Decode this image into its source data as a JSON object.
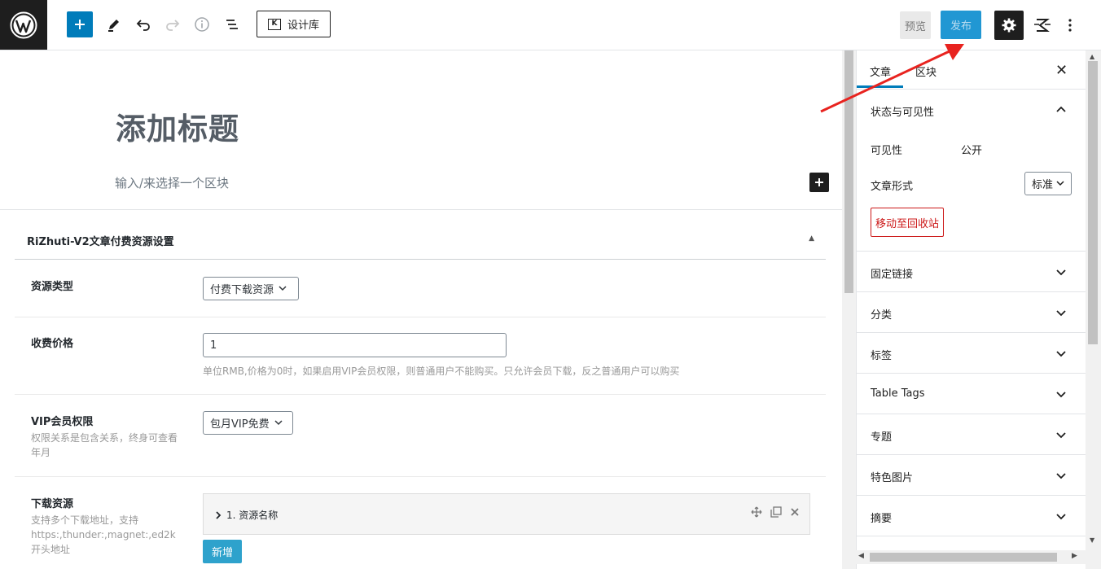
{
  "toolbar": {
    "design_library_label": "设计库",
    "preview_label": "预览",
    "publish_label": "发布"
  },
  "editor": {
    "title_placeholder": "添加标题",
    "block_placeholder": "输入/来选择一个区块"
  },
  "metabox": {
    "title": "RiZhuti-V2文章付费资源设置",
    "resource_type": {
      "label": "资源类型",
      "value": "付费下载资源"
    },
    "price": {
      "label": "收费价格",
      "value": "1",
      "help": "单位RMB,价格为0时，如果启用VIP会员权限，则普通用户不能购买。只允许会员下载，反之普通用户可以购买"
    },
    "vip": {
      "label": "VIP会员权限",
      "desc": "权限关系是包含关系，终身可查看年月",
      "value": "包月VIP免费"
    },
    "downloads": {
      "label": "下载资源",
      "desc": "支持多个下载地址，支持https:,thunder:,magnet:,ed2k 开头地址",
      "item_title": "1. 资源名称",
      "add_label": "新增"
    }
  },
  "sidebar": {
    "tabs": [
      {
        "label": "文章"
      },
      {
        "label": "区块"
      }
    ],
    "status_panel": {
      "title": "状态与可见性",
      "visibility_label": "可见性",
      "visibility_value": "公开",
      "format_label": "文章形式",
      "format_value": "标准",
      "trash_label": "移动至回收站"
    },
    "panels": [
      {
        "title": "固定链接"
      },
      {
        "title": "分类"
      },
      {
        "title": "标签"
      },
      {
        "title": "Table Tags"
      },
      {
        "title": "专题"
      },
      {
        "title": "特色图片"
      },
      {
        "title": "摘要"
      }
    ]
  },
  "colors": {
    "accent": "#007cba",
    "publish": "#2197d3",
    "danger": "#cc1818",
    "annotation_arrow": "#e8231f"
  }
}
